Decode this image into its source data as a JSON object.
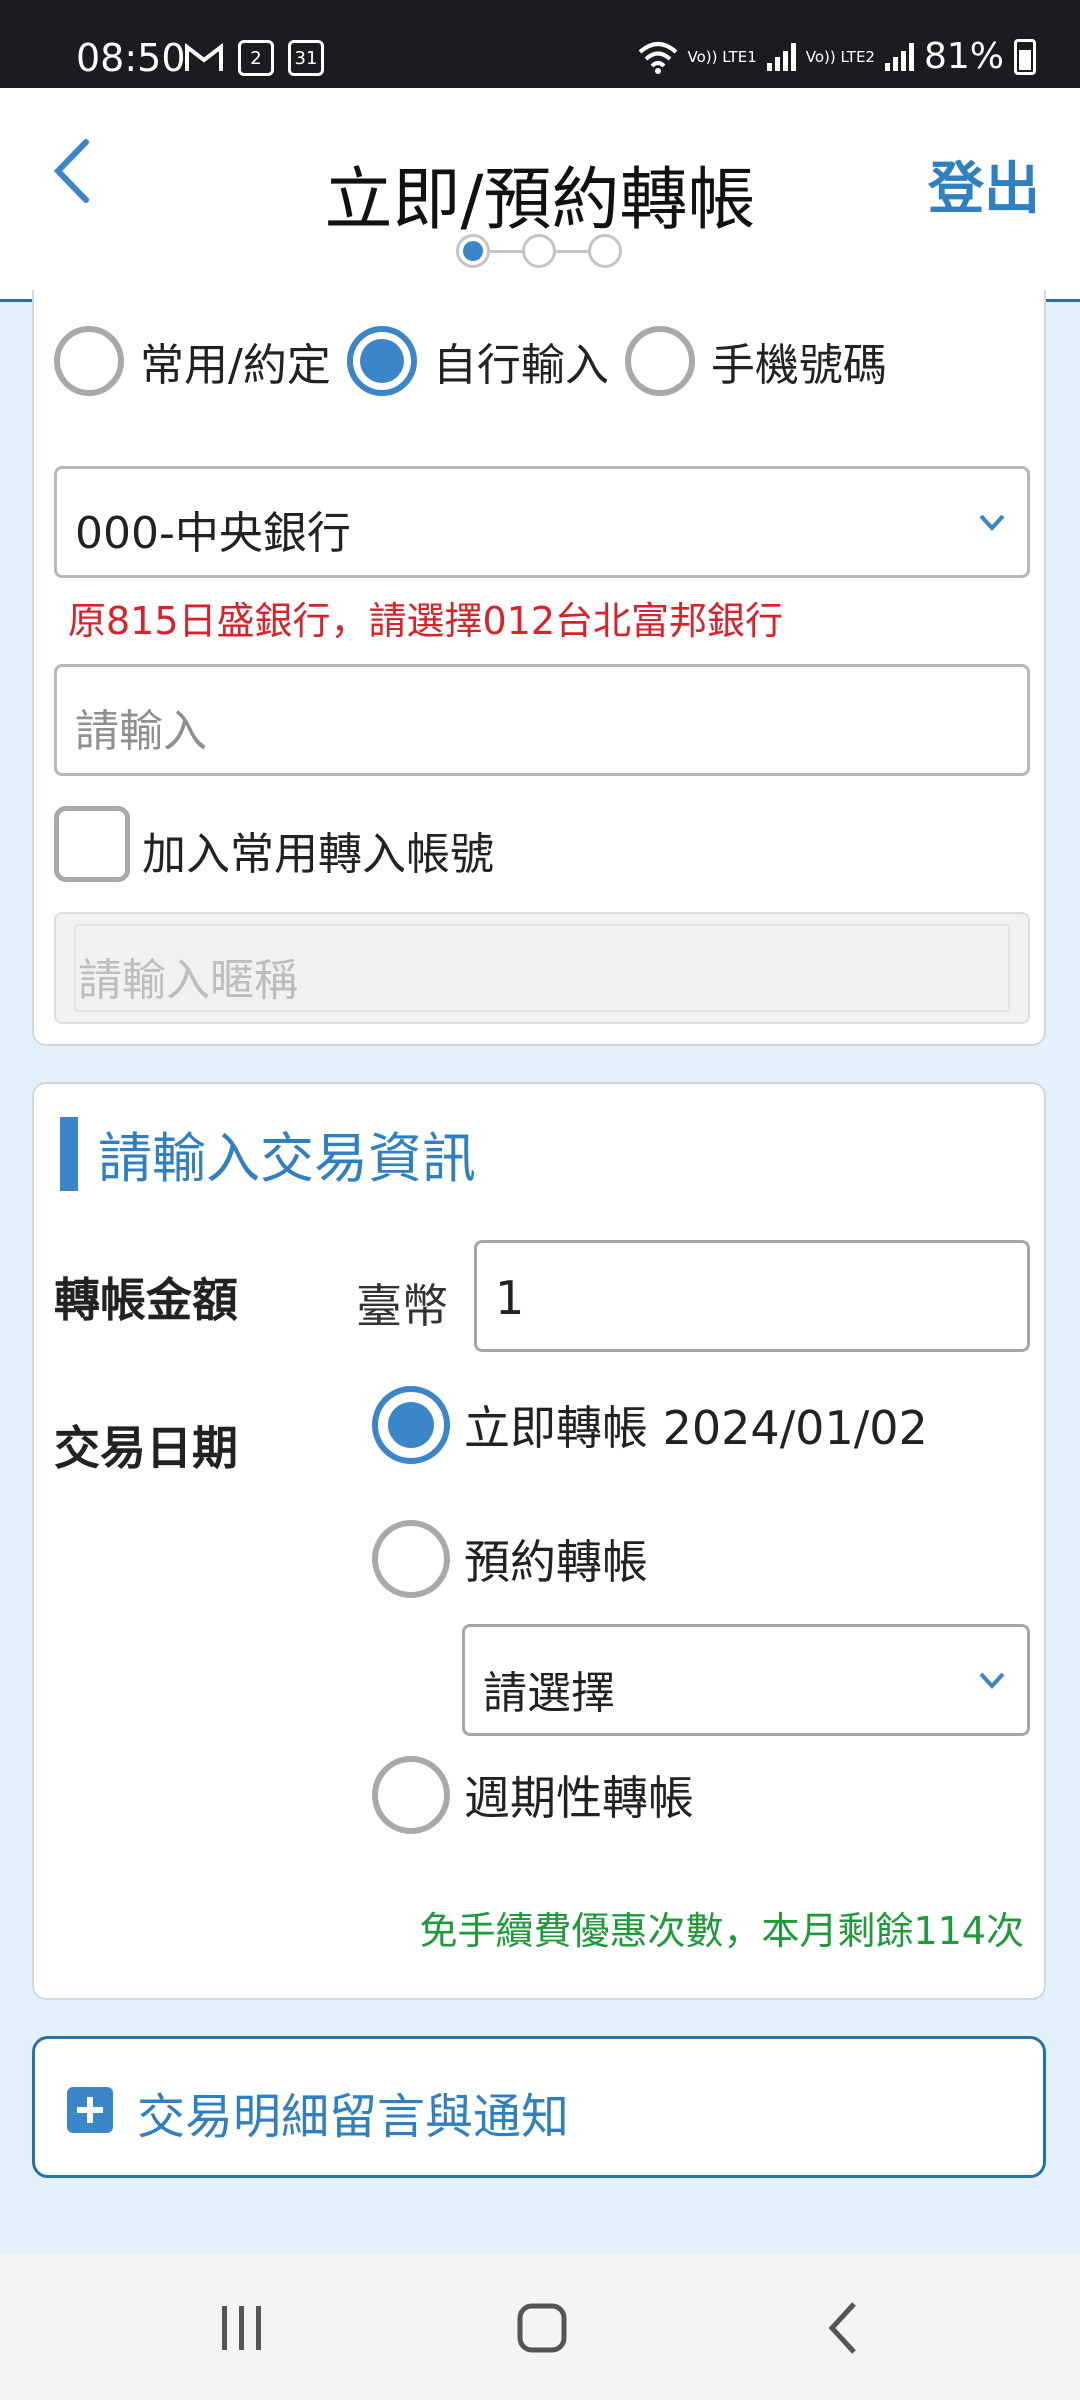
{
  "status_bar": {
    "time": "08:50",
    "notif_icons": [
      "gmail-icon",
      "calendar-2-icon",
      "calendar-31-icon"
    ],
    "calendar_day_a": "2",
    "calendar_day_b": "31",
    "lte1": "Vo)) LTE1",
    "lte2": "Vo)) LTE2",
    "battery": "81%"
  },
  "header": {
    "title": "立即/預約轉帳",
    "logout": "登出",
    "steps_total": 3,
    "step_current": 1
  },
  "payee": {
    "options": [
      {
        "label": "常用/約定",
        "selected": false
      },
      {
        "label": "自行輸入",
        "selected": true
      },
      {
        "label": "手機號碼",
        "selected": false
      }
    ],
    "bank_select": "000-中央銀行",
    "bank_notice": "原815日盛銀行，請選擇012台北富邦銀行",
    "account_placeholder": "請輸入",
    "add_favorite_label": "加入常用轉入帳號",
    "add_favorite_checked": false,
    "nickname_placeholder": "請輸入暱稱"
  },
  "transaction": {
    "section_title": "請輸入交易資訊",
    "amount_label": "轉帳金額",
    "currency": "臺幣",
    "amount": "1",
    "date_label": "交易日期",
    "immediate_label": "立即轉帳 2024/01/02",
    "immediate_selected": true,
    "reserve_label": "預約轉帳",
    "reserve_select": "請選擇",
    "periodic_label": "週期性轉帳",
    "fee_note": "免手續費優惠次數，本月剩餘114次"
  },
  "details": {
    "label": "交易明細留言與通知"
  },
  "colors": {
    "accent": "#3b86c9",
    "warning": "#d8232a",
    "success": "#1f9a3a"
  }
}
